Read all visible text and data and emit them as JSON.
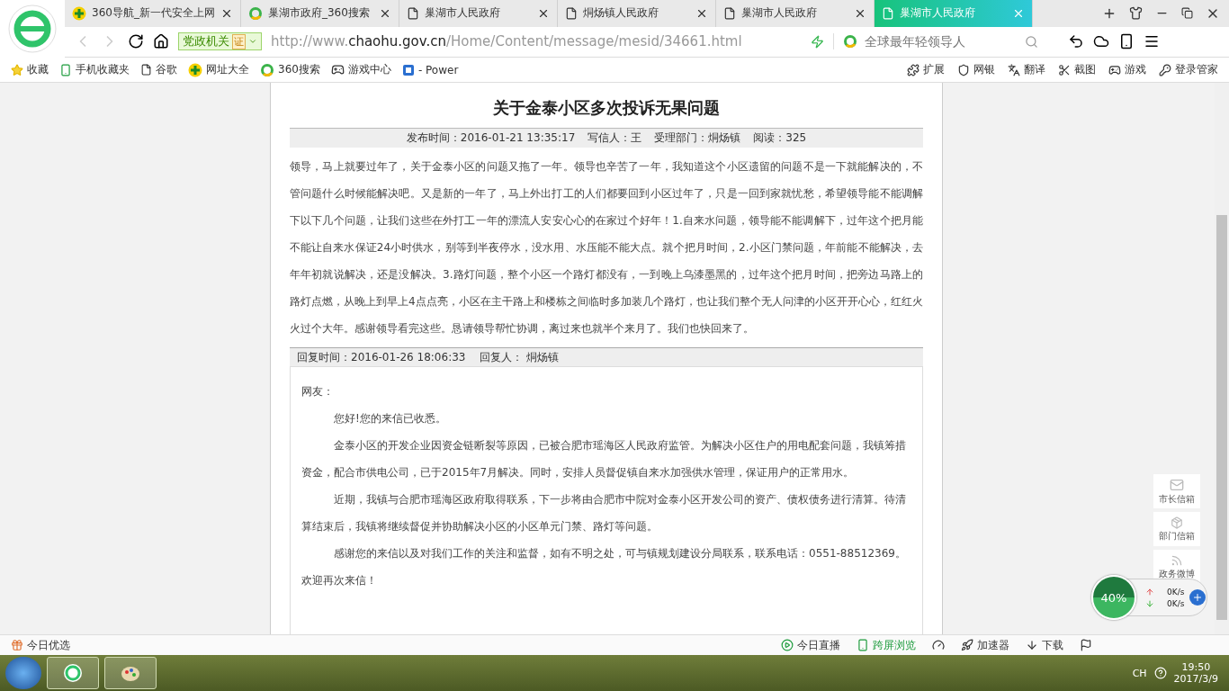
{
  "tabs": [
    {
      "kind": "nav",
      "label": "360导航_新一代安全上网",
      "selected": false
    },
    {
      "kind": "search",
      "label": "巢湖市政府_360搜索",
      "selected": false
    },
    {
      "kind": "page",
      "label": "巢湖市人民政府",
      "selected": false
    },
    {
      "kind": "page",
      "label": "烔炀镇人民政府",
      "selected": false
    },
    {
      "kind": "page",
      "label": "巢湖市人民政府",
      "selected": false
    },
    {
      "kind": "page",
      "label": "巢湖市人民政府",
      "selected": true
    }
  ],
  "address_bar": {
    "badge": "党政机关",
    "cert": "证",
    "url_prefix": "http://www.",
    "url_host": "chaohu.gov.cn",
    "url_path": "/Home/Content/message/mesid/34661.html",
    "search_placeholder": "全球最年轻领导人"
  },
  "bookmarks": [
    {
      "kind": "star",
      "label": "收藏"
    },
    {
      "kind": "phone",
      "label": "手机收藏夹"
    },
    {
      "kind": "page",
      "label": "谷歌"
    },
    {
      "kind": "nav",
      "label": "网址大全"
    },
    {
      "kind": "search",
      "label": "360搜索"
    },
    {
      "kind": "game",
      "label": "游戏中心"
    },
    {
      "kind": "logo",
      "label": "- Power"
    }
  ],
  "extensions": [
    "扩展",
    "网银",
    "翻译",
    "截图",
    "游戏",
    "登录管家"
  ],
  "article": {
    "title": "关于金泰小区多次投诉无果问题",
    "meta": [
      "发布时间：2016-01-21 13:35:17",
      "写信人：王",
      "受理部门：烔炀镇",
      "阅读：325"
    ],
    "body": "领导，马上就要过年了，关于金泰小区的问题又拖了一年。领导也辛苦了一年，我知道这个小区遗留的问题不是一下就能解决的，不管问题什么时候能解决吧。又是新的一年了，马上外出打工的人们都要回到小区过年了，只是一回到家就忧愁，希望领导能不能调解下以下几个问题，让我们这些在外打工一年的漂流人安安心心的在家过个好年！1.自来水问题，领导能不能调解下，过年这个把月能不能让自来水保证24小时供水，别等到半夜停水，没水用、水压能不能大点。就个把月时间，2.小区门禁问题，年前能不能解决，去年年初就说解决，还是没解决。3.路灯问题，整个小区一个路灯都没有，一到晚上乌漆墨黑的，过年这个把月时间，把旁边马路上的路灯点燃，从晚上到早上4点点亮，小区在主干路上和楼栋之间临时多加装几个路灯，也让我们整个无人问津的小区开开心心，红红火火过个大年。感谢领导看完这些。恳请领导帮忙协调，离过来也就半个来月了。我们也快回来了。",
    "reply_meta": [
      "回复时间：2016-01-26 18:06:33",
      "回复人： 烔炀镇"
    ],
    "reply": [
      {
        "kind": "plain",
        "text": "网友："
      },
      {
        "kind": "indent",
        "text": "您好!您的来信已收悉。"
      },
      {
        "kind": "indent",
        "text": "金泰小区的开发企业因资金链断裂等原因，已被合肥市瑶海区人民政府监管。为解决小区住户的用电配套问题，我镇筹措资金，配合市供电公司，已于2015年7月解决。同时，安排人员督促镇自来水加强供水管理，保证用户的正常用水。"
      },
      {
        "kind": "indent",
        "text": "近期，我镇与合肥市瑶海区政府取得联系，下一步将由合肥市中院对金泰小区开发公司的资产、债权债务进行清算。待清算结束后，我镇将继续督促并协助解决小区的小区单元门禁、路灯等问题。"
      },
      {
        "kind": "indent",
        "text": "感谢您的来信以及对我们工作的关注和监督，如有不明之处，可与镇规划建设分局联系，联系电话：0551-88512369。"
      },
      {
        "kind": "plain",
        "text": "欢迎再次来信！"
      }
    ]
  },
  "side_links": [
    {
      "kind": "mail",
      "label": "市长信箱"
    },
    {
      "kind": "box",
      "label": "部门信箱"
    },
    {
      "kind": "weibo",
      "label": "政务微博"
    }
  ],
  "speed_widget": {
    "percent": "40%",
    "upload": "0K/s",
    "download": "0K/s"
  },
  "status_bar": {
    "left": "今日优选",
    "items": [
      {
        "kind": "play",
        "label": "今日直播",
        "highlight": false
      },
      {
        "kind": "phone",
        "label": "跨屏浏览",
        "highlight": true
      },
      {
        "kind": "speed",
        "highlight": false
      },
      {
        "kind": "rocket",
        "label": "加速器",
        "highlight": false
      },
      {
        "kind": "download",
        "label": "下载",
        "highlight": false
      }
    ]
  },
  "taskbar": {
    "language": "CH",
    "time": "19:50",
    "date": "2017/3/9"
  }
}
